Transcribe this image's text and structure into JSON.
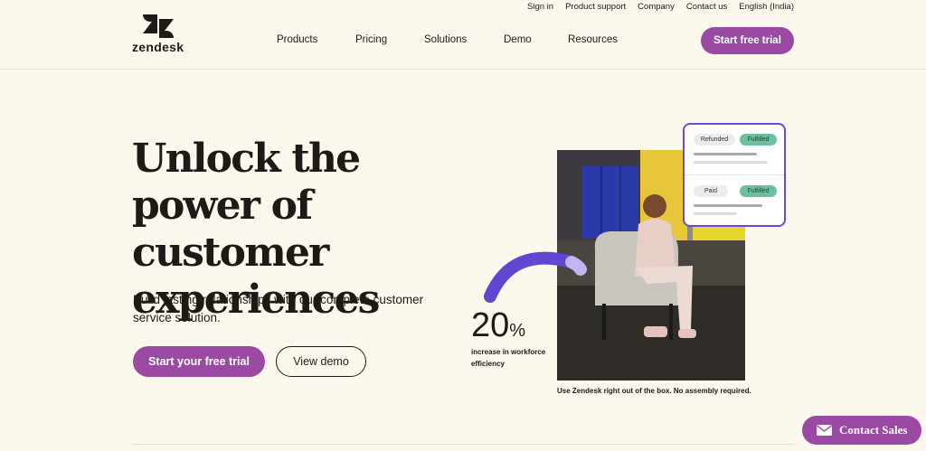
{
  "brand": {
    "name": "zendesk",
    "accent": "#9a4aa3"
  },
  "utility_nav": [
    "Sign in",
    "Product support",
    "Company",
    "Contact us",
    "English (India)"
  ],
  "main_nav": [
    "Products",
    "Pricing",
    "Solutions",
    "Demo",
    "Resources"
  ],
  "header_cta": "Start free trial",
  "hero": {
    "headline": "Unlock the power of customer experiences",
    "subheadline": "Build lasting relationships with our complete customer service solution.",
    "primary_cta": "Start your free trial",
    "secondary_cta": "View demo"
  },
  "stat": {
    "value": "20",
    "unit": "%",
    "label": "increase in workforce efficiency"
  },
  "status_card": {
    "rows": [
      {
        "tag": "Refunded",
        "status": "Fulfilled"
      },
      {
        "tag": "Paid",
        "status": "Fulfilled"
      }
    ]
  },
  "image_caption": "Use Zendesk right out of the box. No assembly required.",
  "floating_button": {
    "label": "Contact Sales",
    "icon": "mail-icon"
  }
}
